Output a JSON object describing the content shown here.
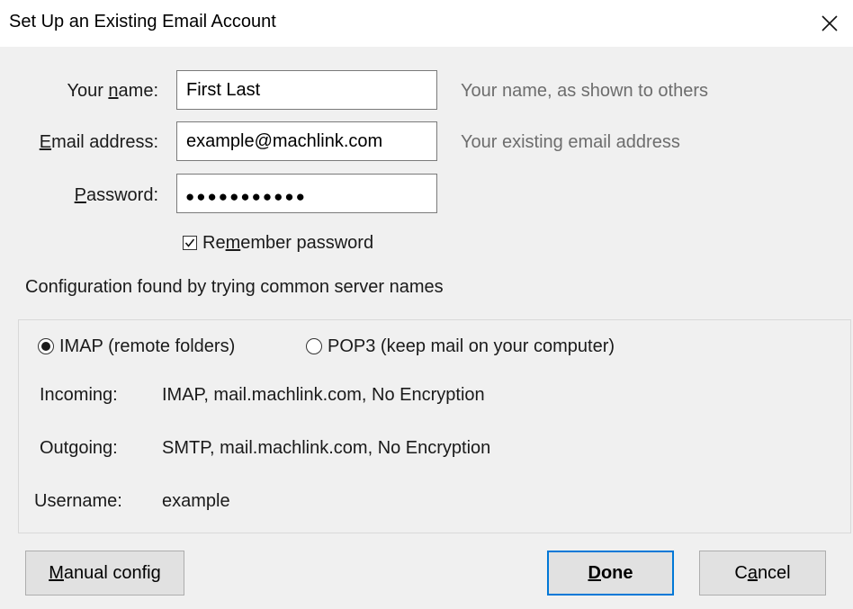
{
  "window": {
    "title": "Set Up an Existing Email Account",
    "close_icon": "close-icon"
  },
  "form": {
    "name": {
      "label_prefix": "Your ",
      "label_access": "n",
      "label_suffix": "ame:",
      "value": "First Last",
      "hint": "Your name, as shown to others"
    },
    "email": {
      "label_access": "E",
      "label_suffix": "mail address:",
      "value": "example@machlink.com",
      "hint": "Your existing email address"
    },
    "password": {
      "label_access": "P",
      "label_suffix": "assword:",
      "masked_value": "●●●●●●●●●●●"
    },
    "remember": {
      "label_prefix": "Re",
      "label_access": "m",
      "label_suffix": "ember password",
      "checked": true
    }
  },
  "config": {
    "status": "Configuration found by trying common server names",
    "protocols": [
      {
        "label": "IMAP (remote folders)",
        "selected": true
      },
      {
        "label": "POP3 (keep mail on your computer)",
        "selected": false
      }
    ],
    "incoming": {
      "label": "Incoming:",
      "value": "IMAP, mail.machlink.com, No Encryption"
    },
    "outgoing": {
      "label": "Outgoing:",
      "value": "SMTP, mail.machlink.com, No Encryption"
    },
    "username": {
      "label": "Username:",
      "value": "example"
    }
  },
  "buttons": {
    "manual": {
      "access": "M",
      "rest": "anual config"
    },
    "done": {
      "access": "D",
      "rest": "one"
    },
    "cancel": {
      "prefix": "C",
      "access": "a",
      "rest": "ncel"
    }
  }
}
